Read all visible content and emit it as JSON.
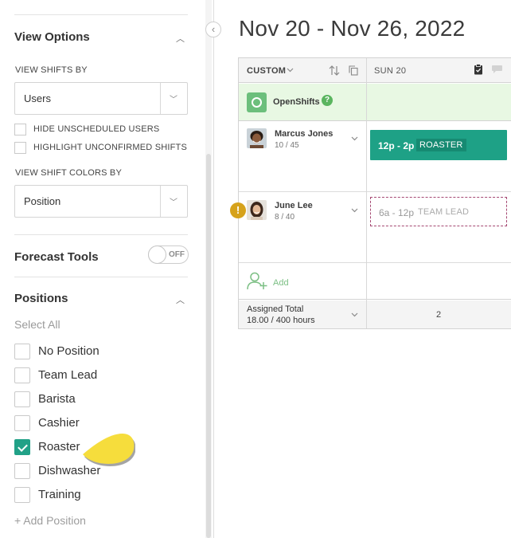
{
  "sidebar": {
    "view_options": {
      "title": "View Options",
      "view_shifts_by_label": "VIEW SHIFTS BY",
      "view_shifts_by_value": "Users",
      "hide_unscheduled_label": "HIDE UNSCHEDULED USERS",
      "highlight_unconfirmed_label": "HIGHLIGHT UNCONFIRMED SHIFTS",
      "view_shift_colors_by_label": "VIEW SHIFT COLORS BY",
      "view_shift_colors_by_value": "Position"
    },
    "forecast": {
      "title": "Forecast Tools",
      "toggle_text": "OFF"
    },
    "positions": {
      "title": "Positions",
      "select_all": "Select All",
      "items": [
        {
          "label": "No Position",
          "checked": false
        },
        {
          "label": "Team Lead",
          "checked": false
        },
        {
          "label": "Barista",
          "checked": false
        },
        {
          "label": "Cashier",
          "checked": false
        },
        {
          "label": "Roaster",
          "checked": true
        },
        {
          "label": "Dishwasher",
          "checked": false
        },
        {
          "label": "Training",
          "checked": false
        }
      ],
      "add_position": "+ Add Position"
    },
    "collapse_icon": "chevron-left-icon"
  },
  "main": {
    "date_range": "Nov 20 - Nov 26, 2022",
    "grid": {
      "header": {
        "custom_label": "CUSTOM",
        "day_label": "SUN 20"
      },
      "openshifts": {
        "label": "OpenShifts",
        "help": "?"
      },
      "users": [
        {
          "name": "Marcus Jones",
          "hours": "10 / 45",
          "shift_time": "12p - 2p",
          "shift_position": "ROASTER",
          "warning": false
        },
        {
          "name": "June Lee",
          "hours": "8 / 40",
          "shift_time": "6a - 12p",
          "shift_position": "TEAM LEAD",
          "warning": true,
          "warning_mark": "!"
        }
      ],
      "add_label": "Add",
      "total": {
        "label": "Assigned Total",
        "hours": "18.00 / 400 hours",
        "day_value": "2"
      }
    },
    "colors": {
      "accent": "#21a187",
      "openshift_bg": "#e8f8e3",
      "warning": "#d6a21b",
      "unconfirmed_border": "#a54872"
    }
  }
}
